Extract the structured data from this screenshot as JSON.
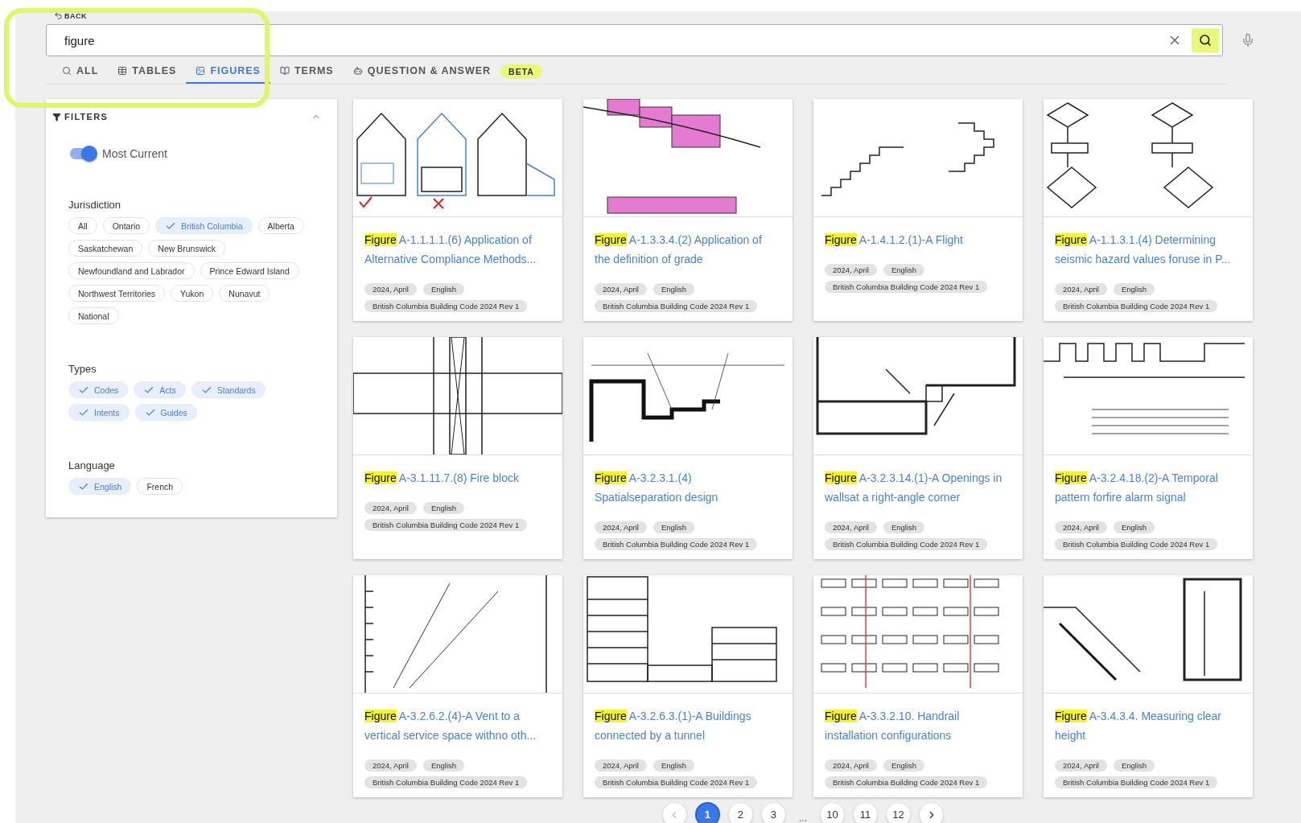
{
  "back": {
    "label": "BACK"
  },
  "search": {
    "value": "figure"
  },
  "tabs": [
    {
      "label": "ALL",
      "selected": false
    },
    {
      "label": "TABLES",
      "selected": false
    },
    {
      "label": "FIGURES",
      "selected": true
    },
    {
      "label": "TERMS",
      "selected": false
    },
    {
      "label": "QUESTION & ANSWER",
      "selected": false,
      "badge": "BETA"
    }
  ],
  "filters": {
    "title": "FILTERS",
    "expanded": true,
    "toggle": {
      "label": "Most Current",
      "on": true
    },
    "groups": [
      {
        "title": "Jurisdiction",
        "chips": [
          {
            "label": "All",
            "selected": false
          },
          {
            "label": "Ontario",
            "selected": false
          },
          {
            "label": "British Columbia",
            "selected": true
          },
          {
            "label": "Alberta",
            "selected": false
          },
          {
            "label": "Saskatchewan",
            "selected": false
          },
          {
            "label": "New Brunswick",
            "selected": false
          },
          {
            "label": "Newfoundland and Labrador",
            "selected": false
          },
          {
            "label": "Prince Edward Island",
            "selected": false
          },
          {
            "label": "Northwest Territories",
            "selected": false
          },
          {
            "label": "Yukon",
            "selected": false
          },
          {
            "label": "Nunavut",
            "selected": false
          },
          {
            "label": "National",
            "selected": false
          }
        ]
      },
      {
        "title": "Types",
        "chips": [
          {
            "label": "Codes",
            "selected": true
          },
          {
            "label": "Acts",
            "selected": true
          },
          {
            "label": "Standards",
            "selected": true
          },
          {
            "label": "Intents",
            "selected": true
          },
          {
            "label": "Guides",
            "selected": true
          }
        ]
      },
      {
        "title": "Language",
        "chips": [
          {
            "label": "English",
            "selected": true
          },
          {
            "label": "French",
            "selected": false
          }
        ]
      }
    ]
  },
  "results": [
    {
      "prefix": "Figure",
      "title": "A-1.1.1.1.(6) Application of Alternative Compliance Methods...",
      "tags": [
        "2024, April",
        "English",
        "British Columbia Building Code 2024 Rev 1"
      ]
    },
    {
      "prefix": "Figure",
      "title": "A-1.3.3.4.(2) Application of the definition of grade",
      "tags": [
        "2024, April",
        "English",
        "British Columbia Building Code 2024 Rev 1"
      ]
    },
    {
      "prefix": "Figure",
      "title": "A-1.4.1.2.(1)-A Flight",
      "tags": [
        "2024, April",
        "English",
        "British Columbia Building Code 2024 Rev 1"
      ]
    },
    {
      "prefix": "Figure",
      "title": "A-1.1.3.1.(4) Determining seismic hazard values foruse in P...",
      "tags": [
        "2024, April",
        "English",
        "British Columbia Building Code 2024 Rev 1"
      ]
    },
    {
      "prefix": "Figure",
      "title": "A-3.1.11.7.(8) Fire block",
      "tags": [
        "2024, April",
        "English",
        "British Columbia Building Code 2024 Rev 1"
      ]
    },
    {
      "prefix": "Figure",
      "title": "A-3.2.3.1.(4) Spatialseparation design",
      "tags": [
        "2024, April",
        "English",
        "British Columbia Building Code 2024 Rev 1"
      ]
    },
    {
      "prefix": "Figure",
      "title": "A-3.2.3.14.(1)-A Openings in wallsat a right-angle corner",
      "tags": [
        "2024, April",
        "English",
        "British Columbia Building Code 2024 Rev 1"
      ]
    },
    {
      "prefix": "Figure",
      "title": "A-3.2.4.18.(2)-A Temporal pattern forfire alarm signal",
      "tags": [
        "2024, April",
        "English",
        "British Columbia Building Code 2024 Rev 1"
      ]
    },
    {
      "prefix": "Figure",
      "title": "A-3.2.6.2.(4)-A Vent to a vertical service space withno oth...",
      "tags": [
        "2024, April",
        "English",
        "British Columbia Building Code 2024 Rev 1"
      ]
    },
    {
      "prefix": "Figure",
      "title": "A-3.2.6.3.(1)-A Buildings connected by a tunnel",
      "tags": [
        "2024, April",
        "English",
        "British Columbia Building Code 2024 Rev 1"
      ]
    },
    {
      "prefix": "Figure",
      "title": "A-3.3.2.10. Handrail installation configurations",
      "tags": [
        "2024, April",
        "English",
        "British Columbia Building Code 2024 Rev 1"
      ]
    },
    {
      "prefix": "Figure",
      "title": "A-3.4.3.4. Measuring clear height",
      "tags": [
        "2024, April",
        "English",
        "British Columbia Building Code 2024 Rev 1"
      ]
    }
  ],
  "pagination": {
    "pages": [
      {
        "kind": "page",
        "label": "1",
        "selected": true
      },
      {
        "kind": "page",
        "label": "2",
        "selected": false
      },
      {
        "kind": "page",
        "label": "3",
        "selected": false
      },
      {
        "kind": "ellipsis",
        "label": "..."
      },
      {
        "kind": "page",
        "label": "10",
        "selected": false
      },
      {
        "kind": "page",
        "label": "11",
        "selected": false
      },
      {
        "kind": "page",
        "label": "12",
        "selected": false
      }
    ],
    "prev_disabled": true
  }
}
